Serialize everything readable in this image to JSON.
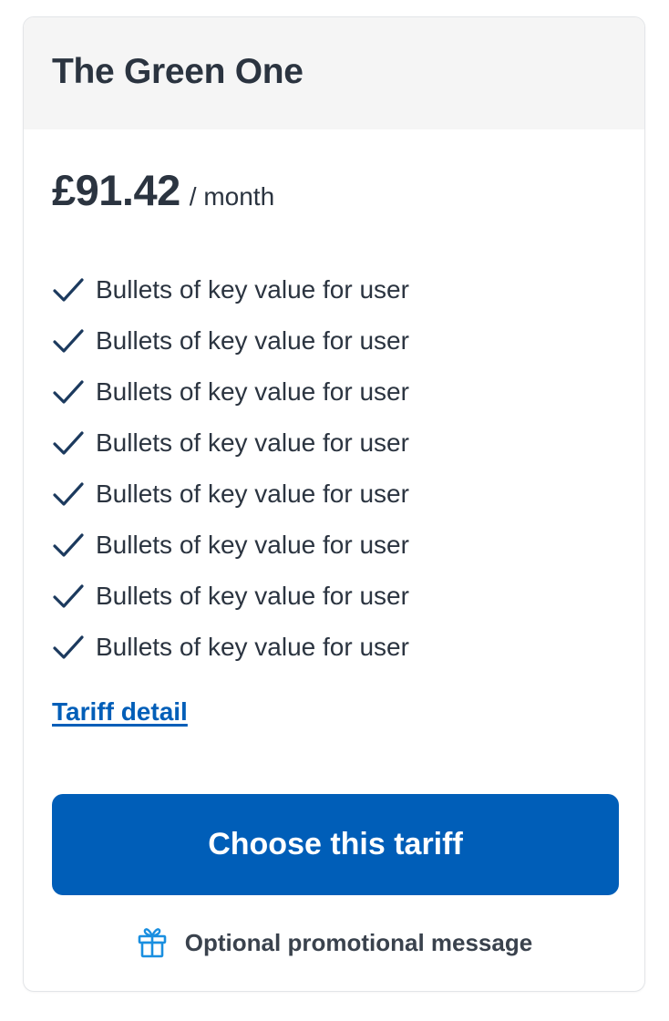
{
  "card": {
    "title": "The Green One",
    "price": {
      "amount": "£91.42",
      "period": "/ month"
    },
    "bullets": [
      {
        "label": "Bullets of key value for user",
        "icon": "check-icon"
      },
      {
        "label": "Bullets of key value for user",
        "icon": "check-icon"
      },
      {
        "label": "Bullets of key value for user",
        "icon": "check-icon"
      },
      {
        "label": "Bullets of key value for user",
        "icon": "check-icon"
      },
      {
        "label": "Bullets of key value for user",
        "icon": "check-icon"
      },
      {
        "label": "Bullets of key value for user",
        "icon": "check-icon"
      },
      {
        "label": "Bullets of key value for user",
        "icon": "check-icon"
      },
      {
        "label": "Bullets of key value for user",
        "icon": "check-icon"
      }
    ],
    "tariff_link_label": "Tariff detail",
    "choose_button_label": "Choose this tariff",
    "promo": {
      "icon": "gift-icon",
      "text": "Optional promotional message"
    }
  },
  "colors": {
    "header_background": "#f5f5f5",
    "text": "#2b3440",
    "primary": "#005eb8",
    "check": "#1c3a5e",
    "gift_icon": "#1a8fe0"
  }
}
